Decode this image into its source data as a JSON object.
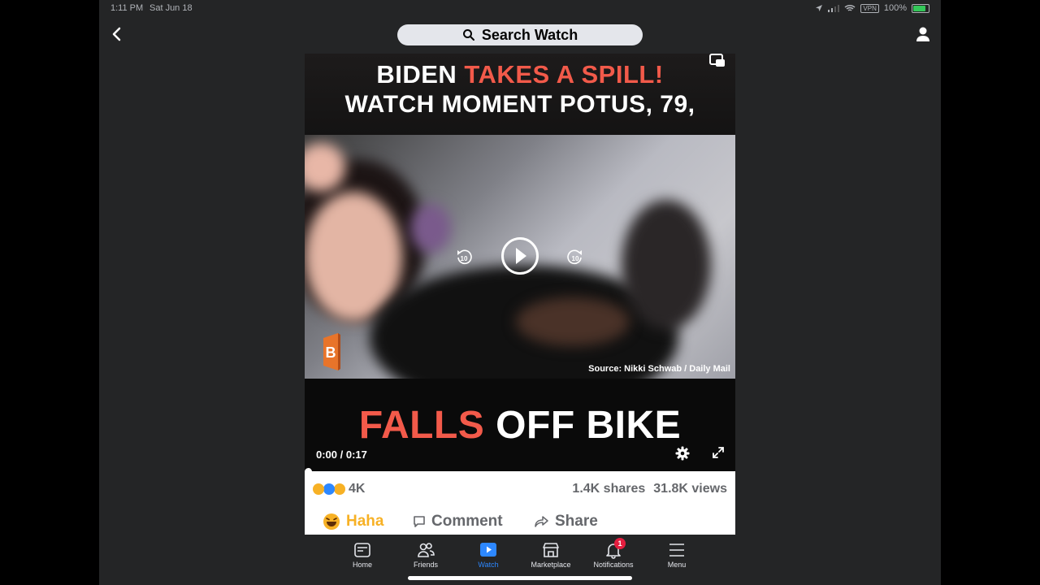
{
  "status_bar": {
    "time": "1:11 PM",
    "date": "Sat Jun 18",
    "vpn": "VPN",
    "battery": "100%"
  },
  "top_bar": {
    "search_placeholder": "Search Watch"
  },
  "video": {
    "headline_line1_a": "BIDEN ",
    "headline_line1_b": "TAKES A SPILL!",
    "headline_line2": "WATCH MOMENT POTUS, 79,",
    "headline_line3_a": "FALLS",
    "headline_line3_b": " OFF BIKE",
    "source": "Source: Nikki Schwab / Daily Mail",
    "logo_letter": "B",
    "elapsed": "0:00",
    "duration": "0:17",
    "skip_seconds": "10",
    "progress": 0
  },
  "engagement": {
    "reaction_count": "4K",
    "shares": "1.4K shares",
    "views": "31.8K views"
  },
  "actions": {
    "haha": "Haha",
    "comment": "Comment",
    "share": "Share"
  },
  "tabs": [
    {
      "label": "Home",
      "icon": "home-icon"
    },
    {
      "label": "Friends",
      "icon": "friends-icon"
    },
    {
      "label": "Watch",
      "icon": "watch-icon"
    },
    {
      "label": "Marketplace",
      "icon": "marketplace-icon"
    },
    {
      "label": "Notifications",
      "icon": "bell-icon",
      "badge": "1"
    },
    {
      "label": "Menu",
      "icon": "menu-icon"
    }
  ],
  "colors": {
    "accent": "#2d88ff",
    "headline_red": "#f25a4a",
    "haha": "#f7b125",
    "badge": "#e41e3f"
  }
}
